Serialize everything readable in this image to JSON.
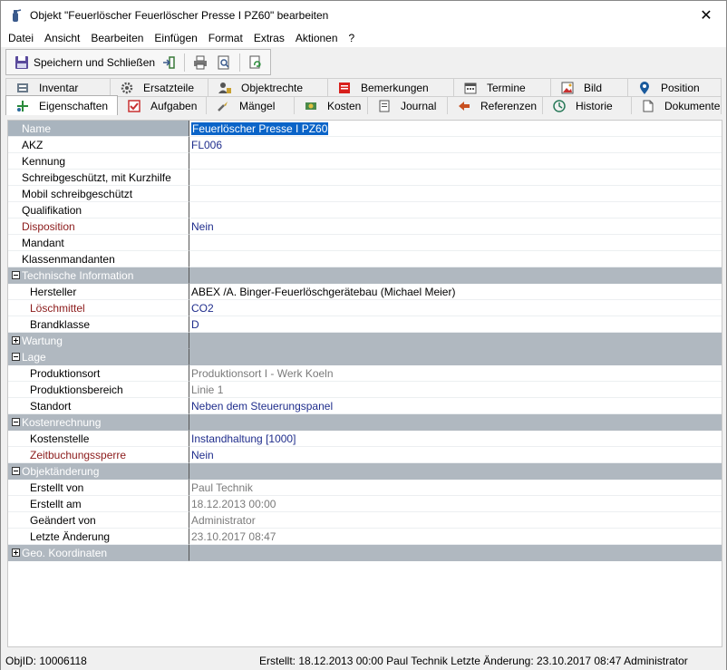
{
  "window": {
    "title": "Objekt \"Feuerlöscher Feuerlöscher Presse I PZ60\" bearbeiten",
    "close_glyph": "✕"
  },
  "menu": [
    "Datei",
    "Ansicht",
    "Bearbeiten",
    "Einfügen",
    "Format",
    "Extras",
    "Aktionen",
    "?"
  ],
  "toolbar": {
    "save_close_label": "Speichern und Schließen"
  },
  "tabs": {
    "row1": [
      {
        "label": "Inventar",
        "icon": "inventory-icon"
      },
      {
        "label": "Ersatzteile",
        "icon": "spare-parts-icon"
      },
      {
        "label": "Objektrechte",
        "icon": "rights-icon"
      },
      {
        "label": "Bemerkungen",
        "icon": "notes-icon"
      },
      {
        "label": "Termine",
        "icon": "calendar-icon"
      },
      {
        "label": "Bild",
        "icon": "image-icon"
      },
      {
        "label": "Position",
        "icon": "location-pin-icon"
      }
    ],
    "row2": [
      {
        "label": "Eigenschaften",
        "icon": "properties-icon",
        "active": true
      },
      {
        "label": "Aufgaben",
        "icon": "tasks-icon"
      },
      {
        "label": "Mängel",
        "icon": "defects-icon"
      },
      {
        "label": "Kosten",
        "icon": "costs-icon"
      },
      {
        "label": "Journal",
        "icon": "journal-icon"
      },
      {
        "label": "Referenzen",
        "icon": "references-icon"
      },
      {
        "label": "Historie",
        "icon": "history-icon"
      },
      {
        "label": "Dokumente",
        "icon": "document-icon"
      }
    ]
  },
  "properties": [
    {
      "label": "Name",
      "value": "Feuerlöscher Presse I PZ60",
      "type": "row",
      "selected": true
    },
    {
      "label": "AKZ",
      "value": "FL006",
      "type": "row",
      "vstyle": "blue"
    },
    {
      "label": "Kennung",
      "value": "",
      "type": "row"
    },
    {
      "label": "Schreibgeschützt, mit Kurzhilfe",
      "value": "",
      "type": "row"
    },
    {
      "label": "Mobil schreibgeschützt",
      "value": "",
      "type": "row"
    },
    {
      "label": "Qualifikation",
      "value": "",
      "type": "row"
    },
    {
      "label": "Disposition",
      "value": "Nein",
      "type": "row",
      "lstyle": "red",
      "vstyle": "blue"
    },
    {
      "label": "Mandant",
      "value": "",
      "type": "row"
    },
    {
      "label": "Klassenmandanten",
      "value": "",
      "type": "row"
    },
    {
      "label": "Technische Information",
      "type": "section",
      "expanded": true
    },
    {
      "label": "Hersteller",
      "value": "ABEX /A. Binger-Feuerlöschgerätebau   (Michael Meier)",
      "type": "sub"
    },
    {
      "label": "Löschmittel",
      "value": "CO2",
      "type": "sub",
      "lstyle": "red",
      "vstyle": "blue"
    },
    {
      "label": "Brandklasse",
      "value": "D",
      "type": "sub",
      "vstyle": "blue"
    },
    {
      "label": "Wartung",
      "type": "section",
      "expanded": false
    },
    {
      "label": "Lage",
      "type": "section",
      "expanded": true
    },
    {
      "label": "Produktionsort",
      "value": "Produktionsort I - Werk Koeln",
      "type": "sub",
      "vstyle": "gray"
    },
    {
      "label": "Produktionsbereich",
      "value": "Linie 1",
      "type": "sub",
      "vstyle": "gray"
    },
    {
      "label": "Standort",
      "value": "Neben dem Steuerungspanel",
      "type": "sub",
      "vstyle": "blue"
    },
    {
      "label": "Kostenrechnung",
      "type": "section",
      "expanded": true
    },
    {
      "label": "Kostenstelle",
      "value": "Instandhaltung [1000]",
      "type": "sub",
      "vstyle": "blue"
    },
    {
      "label": "Zeitbuchungssperre",
      "value": "Nein",
      "type": "sub",
      "lstyle": "red",
      "vstyle": "blue"
    },
    {
      "label": "Objektänderung",
      "type": "section",
      "expanded": true
    },
    {
      "label": "Erstellt von",
      "value": "Paul Technik",
      "type": "sub",
      "vstyle": "gray"
    },
    {
      "label": "Erstellt am",
      "value": "18.12.2013 00:00",
      "type": "sub",
      "vstyle": "gray"
    },
    {
      "label": "Geändert von",
      "value": "Administrator",
      "type": "sub",
      "vstyle": "gray"
    },
    {
      "label": "Letzte Änderung",
      "value": "23.10.2017 08:47",
      "type": "sub",
      "vstyle": "gray"
    },
    {
      "label": "Geo. Koordinaten",
      "type": "section",
      "expanded": false
    }
  ],
  "status": {
    "objid": "ObjID: 10006118",
    "info": "Erstellt: 18.12.2013 00:00 Paul Technik  Letzte Änderung: 23.10.2017 08:47 Administrator"
  },
  "colors": {
    "selection": "#0a64c8",
    "section_band": "#b0b8c0",
    "value_blue": "#1f2d8c",
    "label_red": "#8b1a1a"
  }
}
